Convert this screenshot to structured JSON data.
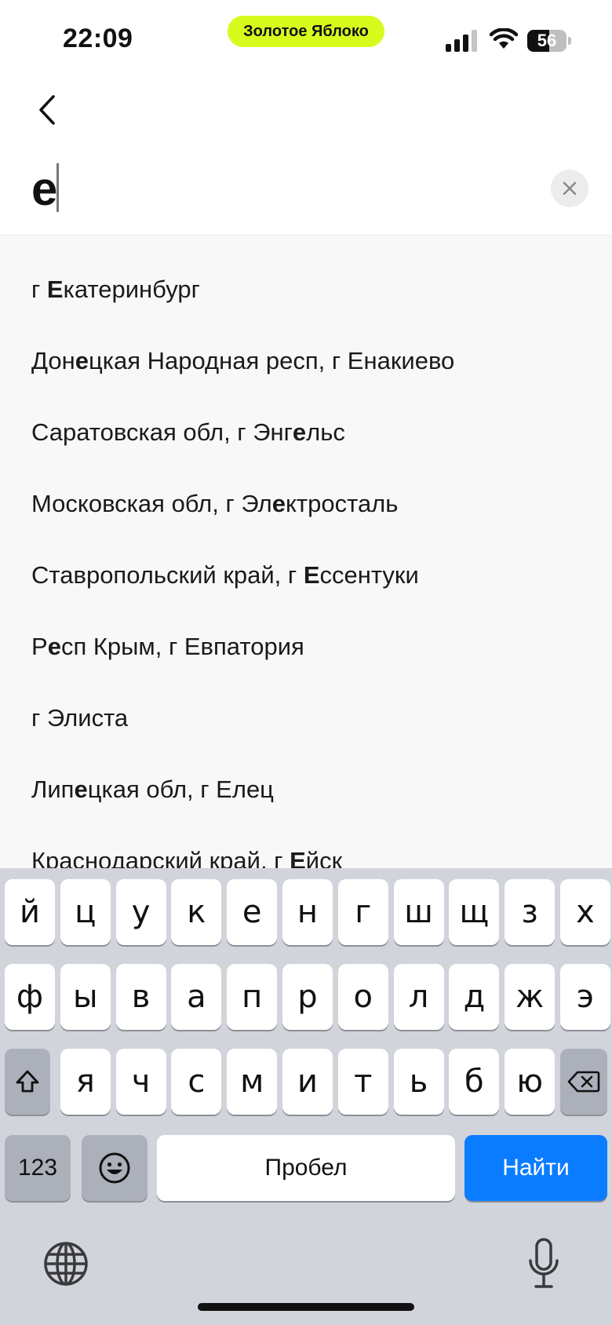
{
  "status_bar": {
    "time": "22:09",
    "carrier_pill": "Золотое Яблоко",
    "battery_percent": "56",
    "battery_level": 0.56,
    "pill_color": "#d8fb1e"
  },
  "search": {
    "query": "е",
    "placeholder": ""
  },
  "suggestions": [
    {
      "parts": [
        [
          "г ",
          false
        ],
        [
          "Е",
          true
        ],
        [
          "катеринбург",
          false
        ]
      ]
    },
    {
      "parts": [
        [
          "Дон",
          false
        ],
        [
          "е",
          true
        ],
        [
          "цкая Народная респ, г Енакиево",
          false
        ]
      ]
    },
    {
      "parts": [
        [
          "Саратовская обл, г Энг",
          false
        ],
        [
          "е",
          true
        ],
        [
          "льс",
          false
        ]
      ]
    },
    {
      "parts": [
        [
          "Московская обл, г Эл",
          false
        ],
        [
          "е",
          true
        ],
        [
          "ктросталь",
          false
        ]
      ]
    },
    {
      "parts": [
        [
          "Ставропольский край, г ",
          false
        ],
        [
          "Е",
          true
        ],
        [
          "ссентуки",
          false
        ]
      ]
    },
    {
      "parts": [
        [
          "Р",
          false
        ],
        [
          "е",
          true
        ],
        [
          "сп Крым, г Евпатория",
          false
        ]
      ]
    },
    {
      "parts": [
        [
          "г Элиста",
          false
        ]
      ]
    },
    {
      "parts": [
        [
          "Лип",
          false
        ],
        [
          "е",
          true
        ],
        [
          "цкая обл, г Елец",
          false
        ]
      ]
    },
    {
      "parts": [
        [
          "Краснодарский край, г ",
          false
        ],
        [
          "Е",
          true
        ],
        [
          "йск",
          false
        ]
      ]
    }
  ],
  "keyboard": {
    "row1": [
      "й",
      "ц",
      "у",
      "к",
      "е",
      "н",
      "г",
      "ш",
      "щ",
      "з",
      "х"
    ],
    "row2": [
      "ф",
      "ы",
      "в",
      "а",
      "п",
      "р",
      "о",
      "л",
      "д",
      "ж",
      "э"
    ],
    "row3": [
      "я",
      "ч",
      "с",
      "м",
      "и",
      "т",
      "ь",
      "б",
      "ю"
    ],
    "numbers_label": "123",
    "space_label": "Пробел",
    "go_label": "Найти",
    "shift_icon": "shift-icon",
    "backspace_icon": "backspace-icon",
    "emoji_icon": "emoji-icon",
    "globe_icon": "globe-icon",
    "mic_icon": "microphone-icon",
    "accent_color": "#0a7cff"
  }
}
